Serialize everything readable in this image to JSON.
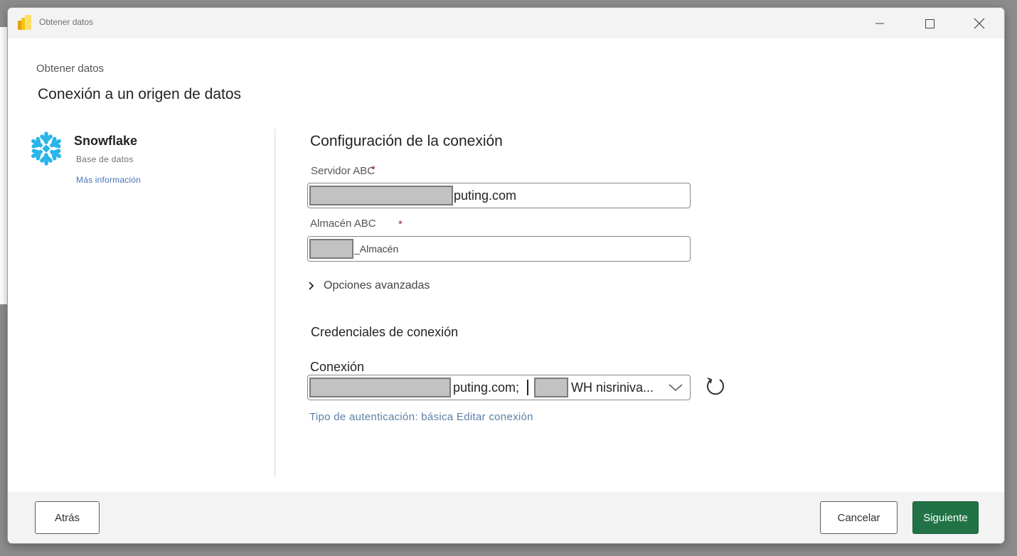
{
  "window": {
    "title": "Obtener datos"
  },
  "header": {
    "breadcrumb": "Obtener datos",
    "title": "Conexión a un origen de datos"
  },
  "source": {
    "name": "Snowflake",
    "category": "Base de datos",
    "more_info": "Más información",
    "icon": "snowflake-icon",
    "color": "#29b5e8"
  },
  "connection_settings": {
    "title": "Configuración de la conexión",
    "server_label": "Servidor ABC",
    "server_value_suffix": "puting.com",
    "warehouse_label": "Almacén ABC",
    "warehouse_value_suffix": "_Almacén",
    "required_mark": "*",
    "advanced_options": "Opciones avanzadas"
  },
  "credentials": {
    "title": "Credenciales de conexión",
    "connection_label": "Conexión",
    "connection_value_part1": "puting.com;",
    "connection_value_part2": "WH nisriniva...",
    "auth_type": "Tipo de autenticación: básica",
    "edit_connection": "Editar conexión"
  },
  "footer": {
    "back": "Atrás",
    "cancel": "Cancelar",
    "next": "Siguiente"
  },
  "colors": {
    "primary_button": "#217346",
    "link": "#4a73b5",
    "required": "#a4262c"
  }
}
